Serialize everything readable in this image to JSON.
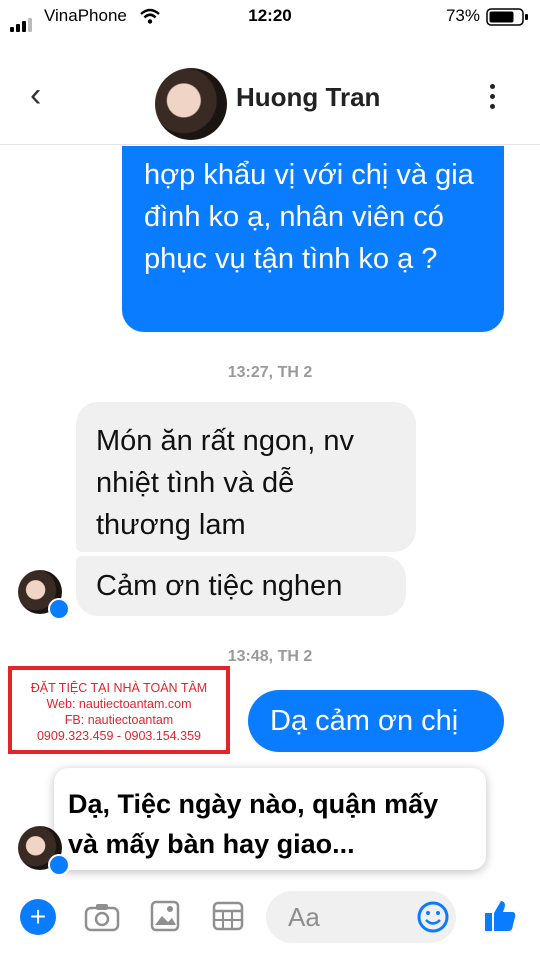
{
  "status_bar": {
    "carrier": "VinaPhone",
    "time": "12:20",
    "battery": "73%"
  },
  "header": {
    "contact_name": "Huong Tran"
  },
  "messages": {
    "out_1": "hợp khẩu vị với chị và gia đình ko ạ, nhân viên có phục vụ tận tình ko ạ ?",
    "time_1": "13:27, TH 2",
    "in_1": "Món ăn rất ngon, nv nhiệt tình và dễ thương lam",
    "in_2": "Cảm ơn tiệc nghen",
    "time_2": "13:48, TH 2",
    "out_2": "Dạ cảm ơn chị",
    "out_3": "Dạ, Tiệc ngày nào, quận mấy và mấy bàn hay giao..."
  },
  "promo": {
    "line1": "ĐẶT TIỆC TẠI NHÀ TOÀN TÂM",
    "line2": "Web: nautiectoantam.com",
    "line3": "FB: nautiectoantam",
    "line4": "0909.323.459 - 0903.154.359"
  },
  "input": {
    "placeholder": "Aa"
  },
  "colors": {
    "accent": "#0a7cff",
    "promo_red": "#e3242b",
    "incoming_bg": "#f1f0f0"
  },
  "icons": [
    "wifi-icon",
    "battery-icon",
    "back-icon",
    "more-icon",
    "messenger-badge-icon",
    "plus-icon",
    "camera-icon",
    "image-icon",
    "grid-icon",
    "emoji-icon",
    "like-icon"
  ]
}
